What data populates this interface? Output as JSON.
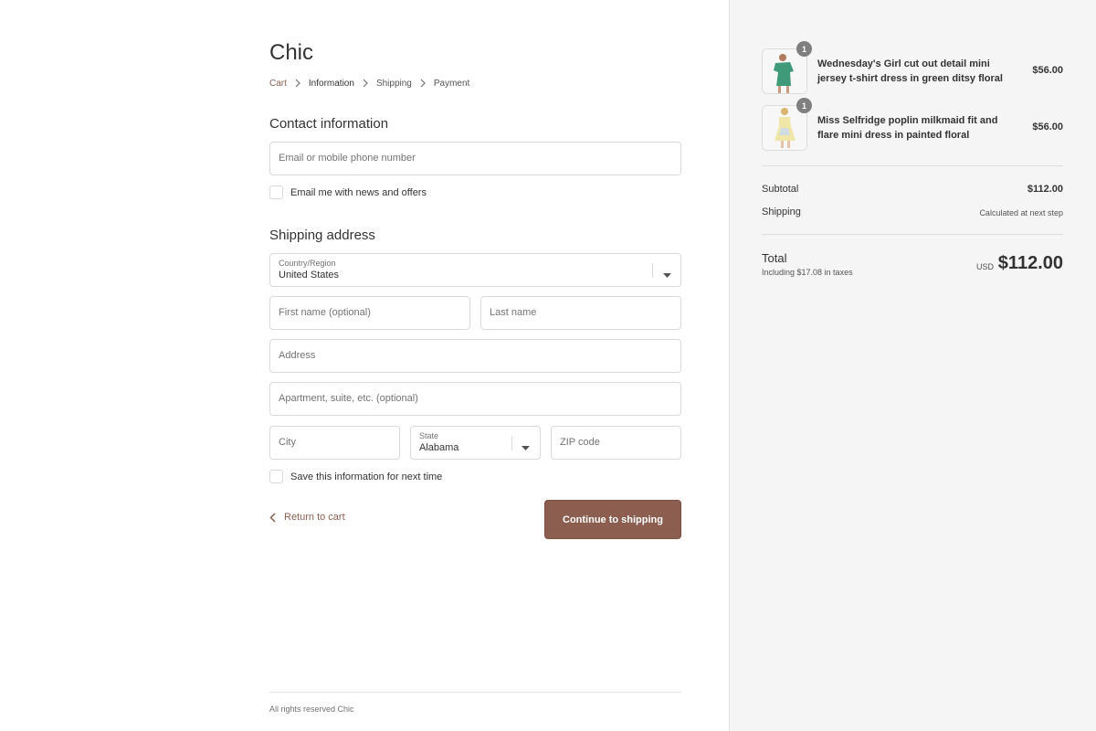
{
  "shop": {
    "name": "Chic"
  },
  "breadcrumb": {
    "cart": "Cart",
    "information": "Information",
    "shipping": "Shipping",
    "payment": "Payment"
  },
  "contact": {
    "title": "Contact information",
    "email_placeholder": "Email or mobile phone number",
    "newsletter_label": "Email me with news and offers"
  },
  "shipping_address": {
    "title": "Shipping address",
    "country_label": "Country/Region",
    "country_value": "United States",
    "first_name_placeholder": "First name (optional)",
    "last_name_placeholder": "Last name",
    "address_placeholder": "Address",
    "apartment_placeholder": "Apartment, suite, etc. (optional)",
    "city_placeholder": "City",
    "state_label": "State",
    "state_value": "Alabama",
    "zip_placeholder": "ZIP code",
    "save_info_label": "Save this information for next time"
  },
  "actions": {
    "return_label": "Return to cart",
    "continue_label": "Continue to shipping"
  },
  "footer": {
    "text": "All rights reserved Chic"
  },
  "order_summary": {
    "items": [
      {
        "name": "Wednesday's Girl cut out detail mini jersey t-shirt dress in green ditsy floral",
        "price": "$56.00",
        "quantity": "1",
        "thumbnail_color": "#3f9a7a"
      },
      {
        "name": "Miss Selfridge poplin milkmaid fit and flare mini dress in painted floral",
        "price": "$56.00",
        "quantity": "1",
        "thumbnail_color": "#efe6a8"
      }
    ],
    "subtotal_label": "Subtotal",
    "subtotal_value": "$112.00",
    "shipping_label": "Shipping",
    "shipping_value": "Calculated at next step",
    "total_label": "Total",
    "tax_note": "Including $17.08 in taxes",
    "currency": "USD",
    "total_value": "$112.00"
  },
  "colors": {
    "accent": "#8b5e4f",
    "sidebar_bg": "#f5f5f5",
    "border": "#d9d9d9"
  }
}
